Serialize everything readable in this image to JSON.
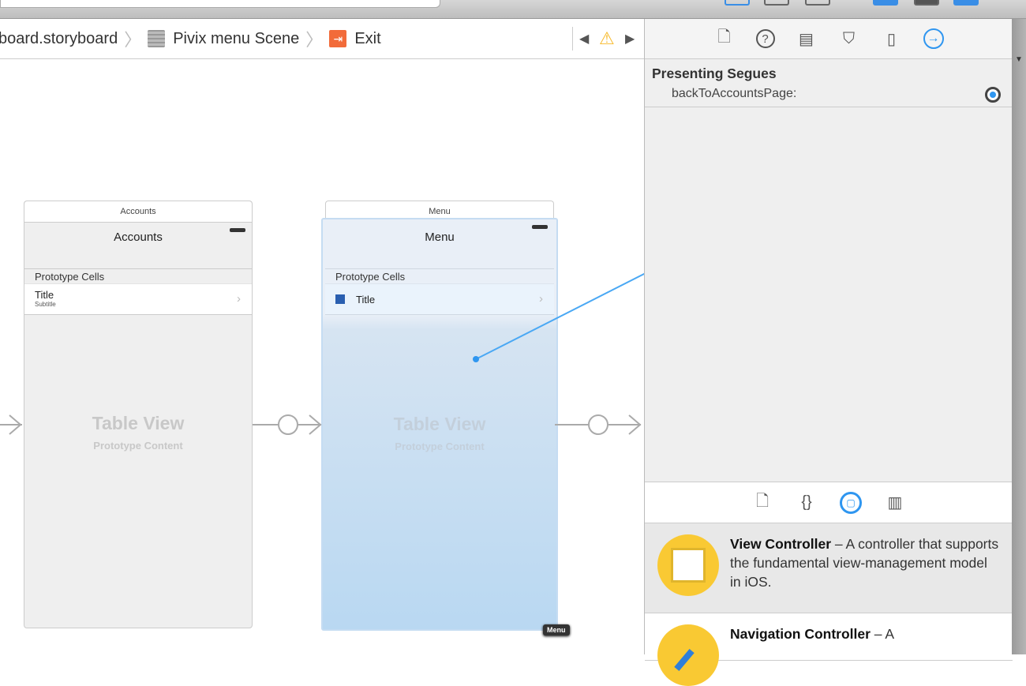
{
  "breadcrumb": {
    "items": [
      "board.storyboard",
      "Pivix menu Scene",
      "Exit"
    ]
  },
  "inspector": {
    "tabs": [
      "file-icon",
      "help-icon",
      "identity-icon",
      "attributes-icon",
      "size-icon",
      "connections-icon"
    ],
    "section_title": "Presenting Segues",
    "segue": "backToAccountsPage:"
  },
  "library": {
    "tabs": [
      "file-template-icon",
      "code-snippet-icon",
      "object-icon",
      "media-icon"
    ],
    "items": [
      {
        "name": "View Controller",
        "desc": " – A controller that supports the fundamental view-management model in iOS."
      },
      {
        "name": "Navigation Controller",
        "desc": " – A"
      }
    ]
  },
  "scenes": [
    {
      "title": "Accounts",
      "nav_title": "Accounts",
      "section": "Prototype Cells",
      "cell_title": "Title",
      "cell_subtitle": "Subtitle",
      "placeholder": "Table View",
      "placeholder_sub": "Prototype Content"
    },
    {
      "title": "Menu",
      "nav_title": "Menu",
      "section": "Prototype Cells",
      "cell_title": "Title",
      "placeholder": "Table View",
      "placeholder_sub": "Prototype Content",
      "badge": "Menu"
    }
  ],
  "colors": {
    "accent": "#2f96f0",
    "exit": "#f26b3a",
    "warning": "#f7b928"
  }
}
